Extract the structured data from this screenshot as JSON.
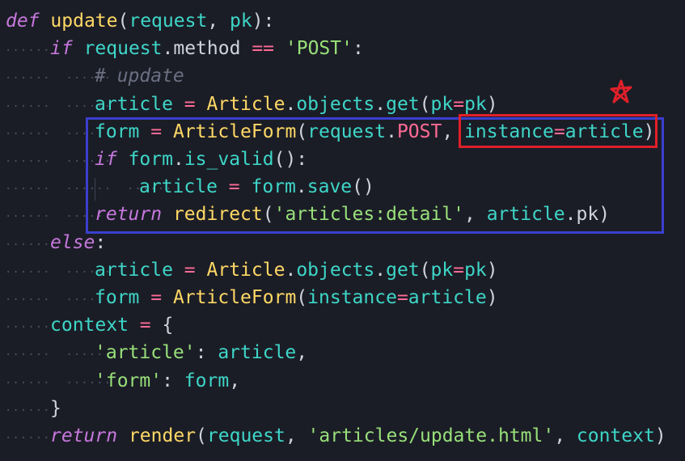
{
  "theme": {
    "background": "#1b1d26",
    "colors": {
      "k": "#c678dd",
      "f": "#ffd866",
      "p": "#3ed6c8",
      "o": "#ff6b96",
      "s": "#98e07a",
      "c": "#6b6f82",
      "t": "#cfd3de"
    },
    "annotation_colors": {
      "red_box": "#e0202a",
      "blue_box": "#3a3fcf",
      "star": "#e0202a"
    }
  },
  "code_lines": [
    {
      "indent": 0,
      "dots": "",
      "tokens": [
        [
          "def",
          "k"
        ],
        [
          " ",
          "t"
        ],
        [
          "update",
          "f"
        ],
        [
          "(",
          "t"
        ],
        [
          "request",
          "p"
        ],
        [
          ", ",
          "t"
        ],
        [
          "pk",
          "p"
        ],
        [
          "):",
          "t"
        ]
      ]
    },
    {
      "indent": 1,
      "dots": "······",
      "tokens": [
        [
          "if",
          "k"
        ],
        [
          " ",
          "t"
        ],
        [
          "request",
          "p"
        ],
        [
          ".",
          "t"
        ],
        [
          "method",
          "t"
        ],
        [
          " ",
          "t"
        ],
        [
          "==",
          "o"
        ],
        [
          " ",
          "t"
        ],
        [
          "'POST'",
          "s"
        ],
        [
          ":",
          "t"
        ]
      ]
    },
    {
      "indent": 2,
      "dots": "······  ······",
      "tokens": [
        [
          "# update",
          "c"
        ]
      ]
    },
    {
      "indent": 2,
      "dots": "······  ······",
      "tokens": [
        [
          "article",
          "p"
        ],
        [
          " ",
          "t"
        ],
        [
          "=",
          "o"
        ],
        [
          " ",
          "t"
        ],
        [
          "Article",
          "f"
        ],
        [
          ".",
          "t"
        ],
        [
          "objects",
          "p"
        ],
        [
          ".",
          "t"
        ],
        [
          "get",
          "p"
        ],
        [
          "(",
          "t"
        ],
        [
          "pk",
          "p"
        ],
        [
          "=",
          "o"
        ],
        [
          "pk",
          "p"
        ],
        [
          ")",
          "t"
        ]
      ]
    },
    {
      "indent": 2,
      "dots": "······  ······",
      "tokens": [
        [
          "form",
          "p"
        ],
        [
          " ",
          "t"
        ],
        [
          "=",
          "o"
        ],
        [
          " ",
          "t"
        ],
        [
          "ArticleForm",
          "f"
        ],
        [
          "(",
          "t"
        ],
        [
          "request",
          "p"
        ],
        [
          ".",
          "t"
        ],
        [
          "POST",
          "o"
        ],
        [
          ", ",
          "t"
        ],
        [
          "instance",
          "p"
        ],
        [
          "=",
          "o"
        ],
        [
          "article",
          "p"
        ],
        [
          ")",
          "t"
        ]
      ]
    },
    {
      "indent": 2,
      "dots": "······  ······",
      "tokens": [
        [
          "if",
          "k"
        ],
        [
          " ",
          "t"
        ],
        [
          "form",
          "p"
        ],
        [
          ".",
          "t"
        ],
        [
          "is_valid",
          "p"
        ],
        [
          "():",
          "t"
        ]
      ]
    },
    {
      "indent": 3,
      "dots": "······  ······  ······",
      "tokens": [
        [
          "article",
          "p"
        ],
        [
          " ",
          "t"
        ],
        [
          "=",
          "o"
        ],
        [
          " ",
          "t"
        ],
        [
          "form",
          "p"
        ],
        [
          ".",
          "t"
        ],
        [
          "save",
          "p"
        ],
        [
          "()",
          "t"
        ]
      ]
    },
    {
      "indent": 2,
      "dots": "······  ······",
      "tokens": [
        [
          "return",
          "k"
        ],
        [
          " ",
          "t"
        ],
        [
          "redirect",
          "f"
        ],
        [
          "(",
          "t"
        ],
        [
          "'articles:detail'",
          "s"
        ],
        [
          ", ",
          "t"
        ],
        [
          "article",
          "p"
        ],
        [
          ".",
          "t"
        ],
        [
          "pk",
          "t"
        ],
        [
          ")",
          "t"
        ]
      ]
    },
    {
      "indent": 1,
      "dots": "······",
      "tokens": [
        [
          "else",
          "k"
        ],
        [
          ":",
          "t"
        ]
      ]
    },
    {
      "indent": 2,
      "dots": "······  ······",
      "tokens": [
        [
          "article",
          "p"
        ],
        [
          " ",
          "t"
        ],
        [
          "=",
          "o"
        ],
        [
          " ",
          "t"
        ],
        [
          "Article",
          "f"
        ],
        [
          ".",
          "t"
        ],
        [
          "objects",
          "p"
        ],
        [
          ".",
          "t"
        ],
        [
          "get",
          "p"
        ],
        [
          "(",
          "t"
        ],
        [
          "pk",
          "p"
        ],
        [
          "=",
          "o"
        ],
        [
          "pk",
          "p"
        ],
        [
          ")",
          "t"
        ]
      ]
    },
    {
      "indent": 2,
      "dots": "······  ······",
      "tokens": [
        [
          "form",
          "p"
        ],
        [
          " ",
          "t"
        ],
        [
          "=",
          "o"
        ],
        [
          " ",
          "t"
        ],
        [
          "ArticleForm",
          "f"
        ],
        [
          "(",
          "t"
        ],
        [
          "instance",
          "p"
        ],
        [
          "=",
          "o"
        ],
        [
          "article",
          "p"
        ],
        [
          ")",
          "t"
        ]
      ]
    },
    {
      "indent": 1,
      "dots": "······",
      "tokens": [
        [
          "context",
          "p"
        ],
        [
          " ",
          "t"
        ],
        [
          "=",
          "o"
        ],
        [
          " {",
          "t"
        ]
      ]
    },
    {
      "indent": 2,
      "dots": "······  ······",
      "tokens": [
        [
          "'article'",
          "s"
        ],
        [
          ": ",
          "t"
        ],
        [
          "article",
          "p"
        ],
        [
          ",",
          "t"
        ]
      ]
    },
    {
      "indent": 2,
      "dots": "······  ······",
      "tokens": [
        [
          "'form'",
          "s"
        ],
        [
          ": ",
          "t"
        ],
        [
          "form",
          "p"
        ],
        [
          ",",
          "t"
        ]
      ]
    },
    {
      "indent": 1,
      "dots": "······",
      "tokens": [
        [
          "}",
          "t"
        ]
      ]
    },
    {
      "indent": 1,
      "dots": "······",
      "tokens": [
        [
          "return",
          "k"
        ],
        [
          " ",
          "t"
        ],
        [
          "render",
          "f"
        ],
        [
          "(",
          "t"
        ],
        [
          "request",
          "p"
        ],
        [
          ", ",
          "t"
        ],
        [
          "'articles/update.html'",
          "s"
        ],
        [
          ", ",
          "t"
        ],
        [
          "context",
          "p"
        ],
        [
          ")",
          "t"
        ]
      ]
    }
  ],
  "annotations": {
    "red_box_label": "instance=article highlight",
    "blue_box_label": "POST branch highlight",
    "star_icon": "star-icon"
  }
}
